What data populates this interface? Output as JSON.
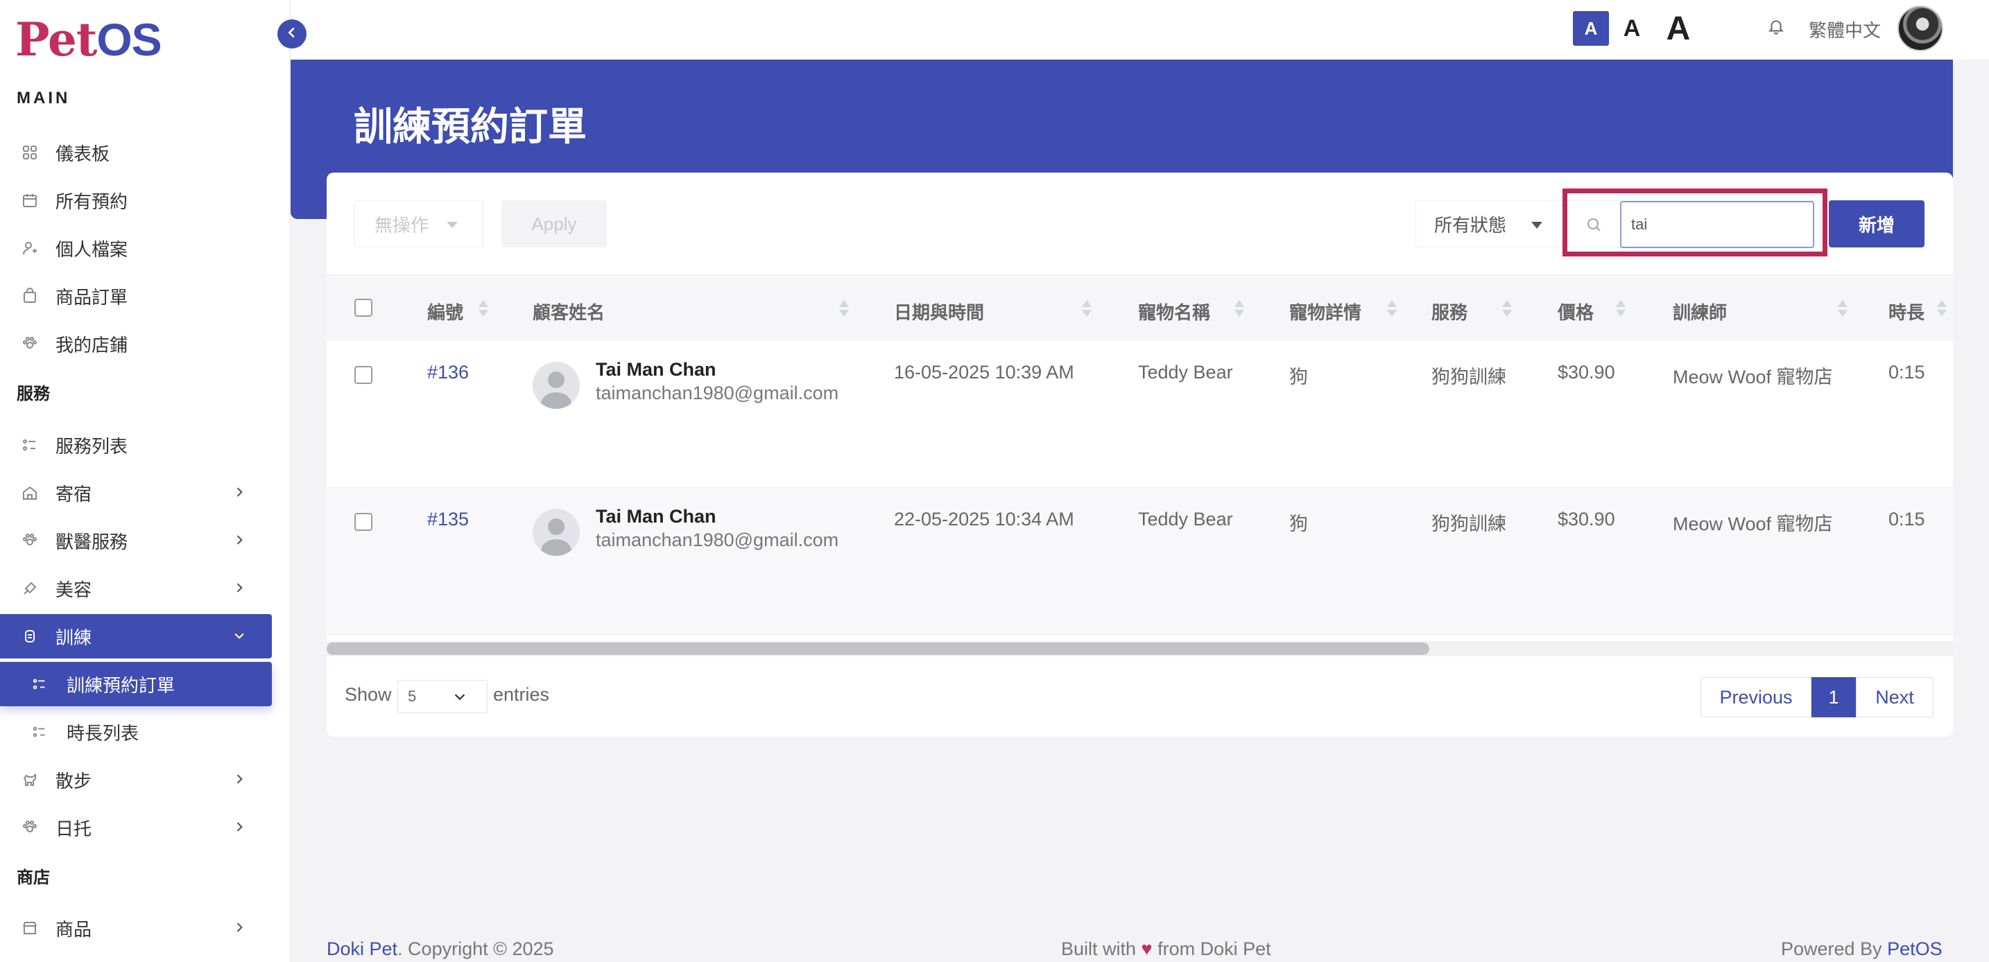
{
  "brand": {
    "logo_p": "P",
    "logo_rest": "et",
    "logo_os": "OS"
  },
  "sidebar": {
    "section_main": "MAIN",
    "section_services": "服務",
    "section_shop": "商店",
    "main_items": [
      {
        "label": "儀表板",
        "icon": "grid-icon"
      },
      {
        "label": "所有預約",
        "icon": "calendar-icon"
      },
      {
        "label": "個人檔案",
        "icon": "user-icon"
      },
      {
        "label": "商品訂單",
        "icon": "bag-icon"
      },
      {
        "label": "我的店鋪",
        "icon": "paw-icon"
      }
    ],
    "service_items": [
      {
        "label": "服務列表",
        "icon": "list-icon"
      },
      {
        "label": "寄宿",
        "icon": "home-icon"
      },
      {
        "label": "獸醫服務",
        "icon": "paw-icon"
      },
      {
        "label": "美容",
        "icon": "brush-icon"
      },
      {
        "label": "訓練",
        "icon": "badge-icon"
      },
      {
        "label": "訓練預約訂單",
        "icon": "list-icon"
      },
      {
        "label": "時長列表",
        "icon": "list-icon"
      },
      {
        "label": "散步",
        "icon": "dog-icon"
      },
      {
        "label": "日托",
        "icon": "paw-icon"
      }
    ],
    "shop_items": [
      {
        "label": "商品",
        "icon": "store-icon"
      }
    ]
  },
  "topbar": {
    "font_small": "A",
    "font_medium": "A",
    "font_large": "A",
    "language": "繁體中文"
  },
  "page": {
    "title": "訓練預約訂單"
  },
  "toolbar": {
    "bulk_action": "無操作",
    "apply_label": "Apply",
    "status_filter": "所有狀態",
    "search_value": "tai",
    "add_label": "新增"
  },
  "table": {
    "columns": [
      "編號",
      "顧客姓名",
      "日期與時間",
      "寵物名稱",
      "寵物詳情",
      "服務",
      "價格",
      "訓練師",
      "時長"
    ],
    "rows": [
      {
        "id": "#136",
        "name": "Tai Man Chan",
        "email": "taimanchan1980@gmail.com",
        "datetime": "16-05-2025 10:39 AM",
        "pet": "Teddy Bear",
        "detail": "狗",
        "service": "狗狗訓練",
        "price": "$30.90",
        "trainer": "Meow Woof 寵物店",
        "duration": "0:15"
      },
      {
        "id": "#135",
        "name": "Tai Man Chan",
        "email": "taimanchan1980@gmail.com",
        "datetime": "22-05-2025 10:34 AM",
        "pet": "Teddy Bear",
        "detail": "狗",
        "service": "狗狗訓練",
        "price": "$30.90",
        "trainer": "Meow Woof 寵物店",
        "duration": "0:15"
      }
    ]
  },
  "pagination": {
    "show_label": "Show",
    "entries_value": "5",
    "entries_label": "entries",
    "previous": "Previous",
    "current": "1",
    "next": "Next"
  },
  "footer": {
    "left_brand": "Doki Pet",
    "left_text": ". Copyright © 2025",
    "mid_text_1": "Built with ",
    "heart": "♥",
    "mid_text_2": " from Doki Pet",
    "right_text": "Powered By ",
    "right_brand": "PetOS"
  },
  "colors": {
    "primary": "#3f4cb0",
    "accent": "#c0305f",
    "highlight": "#b8295a"
  }
}
